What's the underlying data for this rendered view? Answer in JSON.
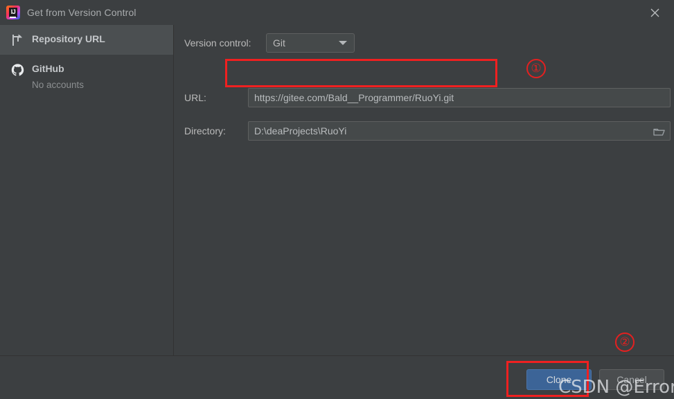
{
  "window": {
    "title": "Get from Version Control",
    "app_icon": "intellij-idea-icon",
    "close_icon": "close-icon"
  },
  "sidebar": {
    "items": [
      {
        "label": "Repository URL",
        "sub": "",
        "icon": "branch-icon",
        "selected": true
      },
      {
        "label": "GitHub",
        "sub": "No accounts",
        "icon": "github-icon",
        "selected": false
      }
    ]
  },
  "form": {
    "version_control": {
      "label": "Version control:",
      "value": "Git",
      "options": [
        "Git"
      ],
      "arrow_icon": "chevron-down-icon"
    },
    "url": {
      "label": "URL:",
      "value": "https://gitee.com/Bald__Programmer/RuoYi.git",
      "placeholder": ""
    },
    "directory": {
      "label": "Directory:",
      "value": "D:\\deaProjects\\RuoYi",
      "placeholder": "",
      "browse_icon": "folder-icon"
    }
  },
  "footer": {
    "clone_label": "Clone",
    "cancel_label": "Cancel"
  },
  "annotations": {
    "marker_one": "①",
    "marker_two": "②",
    "highlight_color": "#f02020"
  },
  "watermark": {
    "text": "CSDN @Error爱我"
  },
  "colors": {
    "background": "#3c3f41",
    "field_background": "#45494a",
    "selected_item": "#4b4f51",
    "primary_button": "#3c6497",
    "border": "#5e6060",
    "annotation_red": "#e42020"
  }
}
